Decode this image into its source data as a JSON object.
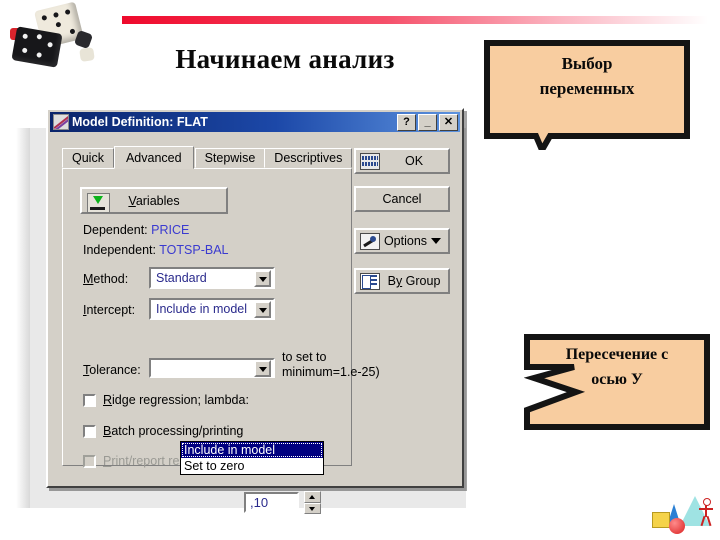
{
  "slide": {
    "title": "Начинаем анализ"
  },
  "decorations": {
    "dice_icon": "dice-clipart",
    "rule_color": "#f21b3c",
    "footer_icon": "geometry-clipart"
  },
  "dialog": {
    "title": "Model Definition: FLAT",
    "title_icon": "chart-icon",
    "titlebar_buttons": [
      {
        "name": "help-button",
        "label": "?"
      },
      {
        "name": "minimize-button",
        "label": "_"
      },
      {
        "name": "close-button",
        "label": "✕"
      }
    ],
    "tabs": [
      {
        "label": "Quick",
        "active": false
      },
      {
        "label": "Advanced",
        "active": true
      },
      {
        "label": "Stepwise",
        "active": false
      },
      {
        "label": "Descriptives",
        "active": false
      }
    ],
    "variables_button": {
      "label_pre": "V",
      "label_post": "ariables"
    },
    "fields": {
      "dependent_label": "Dependent:",
      "dependent_value": "PRICE",
      "independent_label": "Independent:",
      "independent_value": "TOTSP-BAL"
    },
    "method": {
      "label_pre": "M",
      "label_post": "ethod:",
      "value": "Standard"
    },
    "intercept": {
      "label_pre": "I",
      "label_post": "ntercept:",
      "value": "Include in model",
      "options": [
        {
          "label": "Include in model",
          "selected": true
        },
        {
          "label": "Set to zero",
          "selected": false
        }
      ]
    },
    "tolerance": {
      "label_pre": "T",
      "label_post": "olerance:",
      "hint_top": "to set to",
      "hint_bottom": "minimum=1.e-25)"
    },
    "checkboxes": [
      {
        "name": "ridge-regression-checkbox",
        "label_pre": "R",
        "label_post": "idge regression; lambda:",
        "checked": false,
        "disabled": false
      },
      {
        "name": "batch-processing-checkbox",
        "label_pre": "B",
        "label_post": "atch processing/printing",
        "checked": false,
        "disabled": false
      },
      {
        "name": "print-report-residual-checkbox",
        "label_pre": "P",
        "label_post": "rint/report residual analysis",
        "checked": false,
        "disabled": true
      }
    ],
    "lambda_value": ",10",
    "side_buttons": [
      {
        "name": "ok-button",
        "label": "OK",
        "icon": "grid-icon"
      },
      {
        "name": "cancel-button",
        "label": "Cancel",
        "icon": "none"
      },
      {
        "name": "options-button",
        "label": "Options",
        "icon": "wrench-icon",
        "caret": true
      },
      {
        "name": "by-group-button",
        "label_pre": "B",
        "label_mid": "y",
        "label_post": " Group",
        "label": "By Group",
        "icon": "group-icon"
      }
    ]
  },
  "callouts": [
    {
      "name": "callout-variables",
      "line1": "Выбор",
      "line2": "переменных",
      "fill": "#f8cda0",
      "stroke": "#141414"
    },
    {
      "name": "callout-intercept",
      "line1": "Пересечение с",
      "line2": "осью У",
      "fill": "#f8cda0",
      "stroke": "#141414"
    }
  ]
}
